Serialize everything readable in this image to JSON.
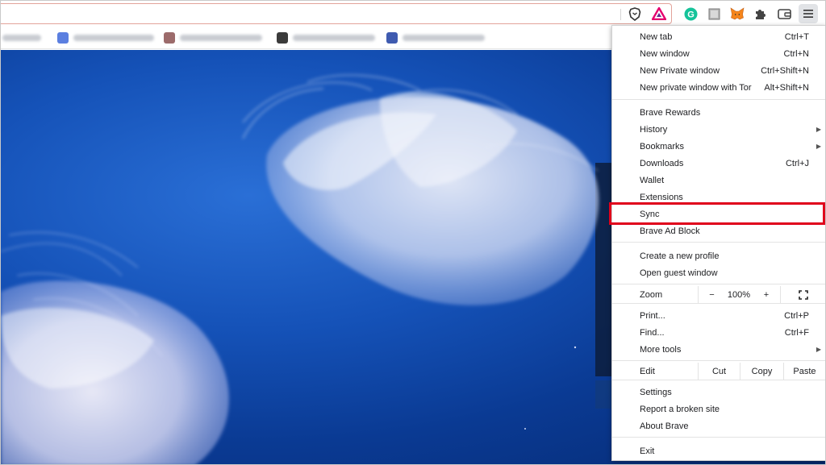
{
  "toolbar": {
    "menu_icon": "hamburger-menu-icon",
    "extensions": [
      "brave-shields-icon",
      "brave-rewards-icon",
      "grammarly-icon",
      "extension-icon",
      "metamask-icon",
      "puzzle-icon",
      "wallet-icon"
    ]
  },
  "menu": {
    "new_tab": {
      "label": "New tab",
      "shortcut": "Ctrl+T"
    },
    "new_window": {
      "label": "New window",
      "shortcut": "Ctrl+N"
    },
    "new_private": {
      "label": "New Private window",
      "shortcut": "Ctrl+Shift+N"
    },
    "new_tor": {
      "label": "New private window with Tor",
      "shortcut": "Alt+Shift+N"
    },
    "rewards": {
      "label": "Brave Rewards"
    },
    "history": {
      "label": "History"
    },
    "bookmarks": {
      "label": "Bookmarks"
    },
    "downloads": {
      "label": "Downloads",
      "shortcut": "Ctrl+J"
    },
    "wallet": {
      "label": "Wallet"
    },
    "extensions": {
      "label": "Extensions"
    },
    "sync": {
      "label": "Sync"
    },
    "adblock": {
      "label": "Brave Ad Block"
    },
    "new_profile": {
      "label": "Create a new profile"
    },
    "guest": {
      "label": "Open guest window"
    },
    "zoom": {
      "label": "Zoom",
      "minus": "−",
      "value": "100%",
      "plus": "+"
    },
    "print": {
      "label": "Print...",
      "shortcut": "Ctrl+P"
    },
    "find": {
      "label": "Find...",
      "shortcut": "Ctrl+F"
    },
    "more_tools": {
      "label": "More tools"
    },
    "edit": {
      "label": "Edit",
      "cut": "Cut",
      "copy": "Copy",
      "paste": "Paste"
    },
    "settings": {
      "label": "Settings"
    },
    "report": {
      "label": "Report a broken site"
    },
    "about": {
      "label": "About Brave"
    },
    "exit": {
      "label": "Exit"
    }
  },
  "colors": {
    "highlight": "#e0001b",
    "menu_hover": "#e1e3e6",
    "page_bg": "#1552b8"
  }
}
